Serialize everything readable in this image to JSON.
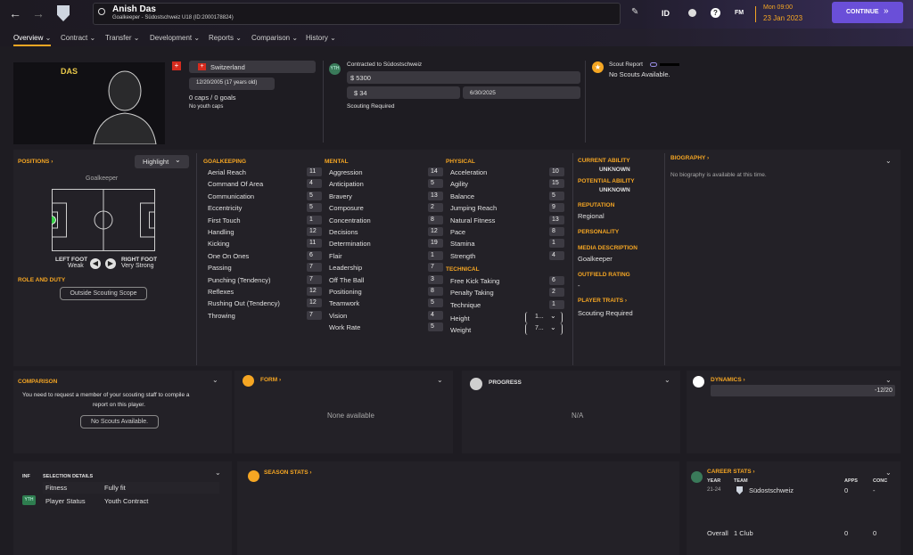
{
  "header": {
    "player_name": "Anish Das",
    "player_sub": "Goalkeeper - Südostschweiz U18 (ID:2000178824)",
    "id_label": "ID",
    "fm_label": "FM",
    "help_label": "?",
    "day_time": "Mon 09:00",
    "date": "23 Jan 2023",
    "continue_label": "CONTINUE"
  },
  "nav": {
    "tabs": [
      "Overview",
      "Contract",
      "Transfer",
      "Development",
      "Reports",
      "Comparison",
      "History"
    ]
  },
  "profile": {
    "short_name": "DAS",
    "nation": "Switzerland",
    "dob": "12/20/2005 (17 years old)",
    "caps": "0 caps / 0 goals",
    "youth_caps": "No youth caps",
    "contract_label": "Contracted to Südostschweiz",
    "wage": "$ 5300",
    "value": "$ 34",
    "expiry": "6/30/2025",
    "scouting": "Scouting Required",
    "scout_report_label": "Scout Report",
    "scout_report_value": "No Scouts Available."
  },
  "positions": {
    "title": "POSITIONS",
    "highlight": "Highlight",
    "position": "Goalkeeper",
    "left_foot_label": "LEFT FOOT",
    "left_foot_value": "Weak",
    "right_foot_label": "RIGHT FOOT",
    "right_foot_value": "Very Strong",
    "role_title": "ROLE AND DUTY",
    "role_button": "Outside Scouting Scope"
  },
  "goalkeeping": {
    "title": "GOALKEEPING",
    "attrs": [
      {
        "name": "Aerial Reach",
        "value": "11"
      },
      {
        "name": "Command Of Area",
        "value": "4"
      },
      {
        "name": "Communication",
        "value": "5"
      },
      {
        "name": "Eccentricity",
        "value": "5"
      },
      {
        "name": "First Touch",
        "value": "1"
      },
      {
        "name": "Handling",
        "value": "12"
      },
      {
        "name": "Kicking",
        "value": "11"
      },
      {
        "name": "One On Ones",
        "value": "6"
      },
      {
        "name": "Passing",
        "value": "7"
      },
      {
        "name": "Punching (Tendency)",
        "value": "7"
      },
      {
        "name": "Reflexes",
        "value": "12"
      },
      {
        "name": "Rushing Out (Tendency)",
        "value": "12"
      },
      {
        "name": "Throwing",
        "value": "7"
      }
    ]
  },
  "mental": {
    "title": "MENTAL",
    "attrs": [
      {
        "name": "Aggression",
        "value": "14"
      },
      {
        "name": "Anticipation",
        "value": "5"
      },
      {
        "name": "Bravery",
        "value": "13"
      },
      {
        "name": "Composure",
        "value": "2"
      },
      {
        "name": "Concentration",
        "value": "8"
      },
      {
        "name": "Decisions",
        "value": "12"
      },
      {
        "name": "Determination",
        "value": "19"
      },
      {
        "name": "Flair",
        "value": "1"
      },
      {
        "name": "Leadership",
        "value": "7"
      },
      {
        "name": "Off The Ball",
        "value": "3"
      },
      {
        "name": "Positioning",
        "value": "8"
      },
      {
        "name": "Teamwork",
        "value": "5"
      },
      {
        "name": "Vision",
        "value": "4"
      },
      {
        "name": "Work Rate",
        "value": "5"
      }
    ]
  },
  "physical": {
    "title": "PHYSICAL",
    "attrs": [
      {
        "name": "Acceleration",
        "value": "10"
      },
      {
        "name": "Agility",
        "value": "15"
      },
      {
        "name": "Balance",
        "value": "5"
      },
      {
        "name": "Jumping Reach",
        "value": "9"
      },
      {
        "name": "Natural Fitness",
        "value": "13"
      },
      {
        "name": "Pace",
        "value": "8"
      },
      {
        "name": "Stamina",
        "value": "1"
      },
      {
        "name": "Strength",
        "value": "4"
      }
    ]
  },
  "technical": {
    "title": "TECHNICAL",
    "attrs": [
      {
        "name": "Free Kick Taking",
        "value": "6"
      },
      {
        "name": "Penalty Taking",
        "value": "2"
      },
      {
        "name": "Technique",
        "value": "1"
      }
    ],
    "height_label": "Height",
    "height_value": "1...",
    "weight_label": "Weight",
    "weight_value": "7..."
  },
  "info": {
    "current_ability_label": "CURRENT ABILITY",
    "current_ability": "UNKNOWN",
    "potential_ability_label": "POTENTIAL ABILITY",
    "potential_ability": "UNKNOWN",
    "reputation_label": "REPUTATION",
    "reputation": "Regional",
    "personality_label": "PERSONALITY",
    "media_label": "MEDIA DESCRIPTION",
    "media": "Goalkeeper",
    "outfield_label": "OUTFIELD RATING",
    "outfield": "-",
    "traits_label": "PLAYER TRAITS",
    "traits": "Scouting Required"
  },
  "biography": {
    "title": "BIOGRAPHY",
    "text": "No biography is available at this time."
  },
  "comparison": {
    "title": "COMPARISON",
    "text1": "You need to request a member of your scouting staff to compile a",
    "text2": "report on this player.",
    "button": "No Scouts Available."
  },
  "form": {
    "title": "FORM",
    "text": "None available"
  },
  "progress": {
    "title": "PROGRESS",
    "text": "N/A"
  },
  "dynamics": {
    "title": "DYNAMICS",
    "value": "-12/20"
  },
  "selection": {
    "inf": "INF",
    "title": "SELECTION DETAILS",
    "fitness_label": "Fitness",
    "fitness_value": "Fully fit",
    "status_label": "Player Status",
    "status_value": "Youth Contract",
    "badge": "YTH"
  },
  "season_stats": {
    "title": "SEASON STATS"
  },
  "career_stats": {
    "title": "CAREER STATS",
    "col_year": "YEAR",
    "col_team": "TEAM",
    "col_apps": "APPS",
    "col_conc": "CONC",
    "row_year": "21-24",
    "row_team": "Südostschweiz",
    "row_apps": "0",
    "row_conc": "-",
    "total_label": "Overall",
    "total_clubs": "1 Club",
    "total_apps": "0",
    "total_conc": "0"
  },
  "colors": {
    "accent": "#f5a623",
    "continue": "#6a4fd8",
    "yth": "#2e7d4f"
  }
}
